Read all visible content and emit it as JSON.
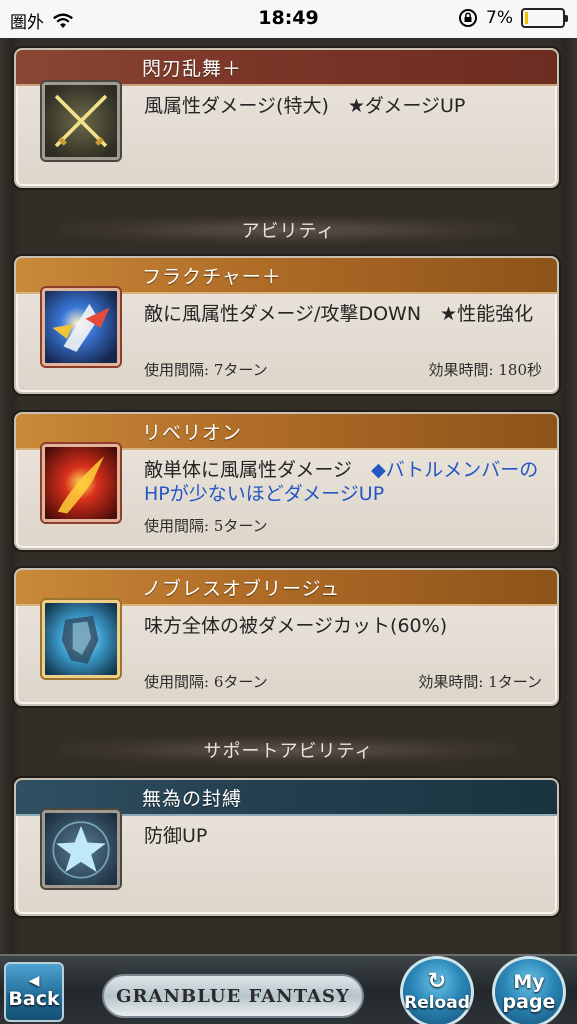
{
  "status_bar": {
    "carrier": "圏外",
    "time": "18:49",
    "battery_percent": "7%",
    "battery_level": 0.07
  },
  "cards": [
    {
      "title": "閃刃乱舞＋",
      "description": "風属性ダメージ(特大)　★ダメージUP",
      "icon": "crossed-swords-icon"
    },
    {
      "title": "フラクチャー＋",
      "description": "敵に風属性ダメージ/攻撃DOWN　★性能強化",
      "interval": "使用間隔: 7ターン",
      "duration": "効果時間: 180秒",
      "icon": "fracture-icon"
    },
    {
      "title": "リベリオン",
      "description": "敵単体に風属性ダメージ　",
      "description_blue": "◆バトルメンバーのHPが少ないほどダメージUP",
      "interval": "使用間隔: 5ターン",
      "icon": "rebellion-icon"
    },
    {
      "title": "ノブレスオブリージュ",
      "description": "味方全体の被ダメージカット(60%)",
      "interval": "使用間隔: 6ターン",
      "duration": "効果時間: 1ターン",
      "icon": "shield-knight-icon"
    },
    {
      "title": "無為の封縛",
      "description": "防御UP",
      "icon": "star-icon"
    }
  ],
  "sections": {
    "ability": "アビリティ",
    "support_ability": "サポートアビリティ"
  },
  "nav": {
    "back_label": "Back",
    "logo_text": "GRANBLUE FANTASY",
    "reload_label": "Reload",
    "mypage_line1": "My",
    "mypage_line2": "page"
  }
}
